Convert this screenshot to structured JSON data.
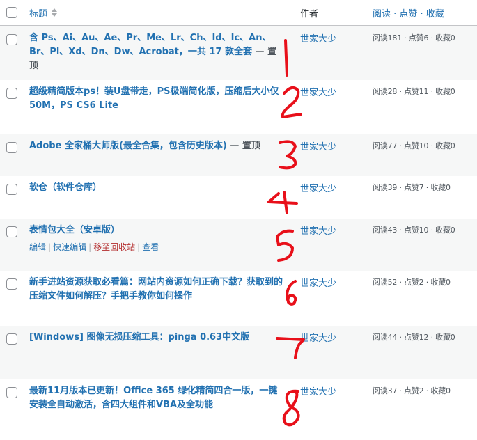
{
  "header": {
    "title_label": "标题",
    "author_label": "作者",
    "stats_label": "阅读 · 点赞 · 收藏"
  },
  "row_actions": {
    "edit": "编辑",
    "quick_edit": "快速编辑",
    "trash": "移至回收站",
    "view": "查看"
  },
  "posts": [
    {
      "title": "含 Ps、Ai、Au、Ae、Pr、Me、Lr、Ch、Id、Ic、An、Br、Pl、Xd、Dn、Dw、Acrobat，一共 17 款全套",
      "state": " — 置顶",
      "author": "世家大少",
      "stats": "阅读181 · 点赞6 · 收藏0"
    },
    {
      "title": "超级精简版本ps！装U盘带走，PS极端简化版，压缩后大小仅50M，PS CS6 Lite",
      "state": "",
      "author": "世家大少",
      "stats": "阅读28 · 点赞11 · 收藏0"
    },
    {
      "title": "Adobe 全家桶大师版(最全合集，包含历史版本)",
      "state": " — 置顶",
      "author": "世家大少",
      "stats": "阅读77 · 点赞10 · 收藏0"
    },
    {
      "title": "软仓（软件仓库）",
      "state": "",
      "author": "世家大少",
      "stats": "阅读39 · 点赞7 · 收藏0"
    },
    {
      "title": "表情包大全（安卓版）",
      "state": "",
      "author": "世家大少",
      "stats": "阅读43 · 点赞10 · 收藏0"
    },
    {
      "title": "新手进站资源获取必看篇：网站内资源如何正确下载？获取到的压缩文件如何解压？手把手教你如何操作",
      "state": "",
      "author": "世家大少",
      "stats": "阅读52 · 点赞2 · 收藏0"
    },
    {
      "title": "[Windows] 图像无损压缩工具：pinga 0.63中文版",
      "state": "",
      "author": "世家大少",
      "stats": "阅读44 · 点赞12 · 收藏0"
    },
    {
      "title": "最新11月版本已更新！Office 365 绿化精简四合一版，一键安装全自动激活，含四大组件和VBA及全功能",
      "state": "",
      "author": "世家大少",
      "stats": "阅读37 · 点赞2 · 收藏0"
    }
  ],
  "annotations": {
    "color": "#e8101a",
    "numbers": [
      "1",
      "2",
      "3",
      "4",
      "5",
      "6",
      "7",
      "8"
    ]
  }
}
